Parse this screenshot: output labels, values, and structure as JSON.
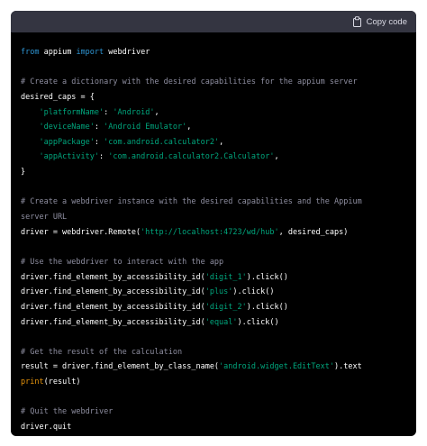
{
  "header": {
    "copy_label": "Copy code"
  },
  "code": {
    "l1": {
      "kw1": "from",
      "t1": " appium ",
      "kw2": "import",
      "t2": " webdriver"
    },
    "l3": "# Create a dictionary with the desired capabilities for the appium server",
    "l4": "desired_caps = {",
    "l5": {
      "pre": "    ",
      "key": "'platformName'",
      "sep": ": ",
      "val": "'Android'",
      "end": ","
    },
    "l6": {
      "pre": "    ",
      "key": "'deviceName'",
      "sep": ": ",
      "val": "'Android Emulator'",
      "end": ","
    },
    "l7": {
      "pre": "    ",
      "key": "'appPackage'",
      "sep": ": ",
      "val": "'com.android.calculator2'",
      "end": ","
    },
    "l8": {
      "pre": "    ",
      "key": "'appActivity'",
      "sep": ": ",
      "val": "'com.android.calculator2.Calculator'",
      "end": ","
    },
    "l9": "}",
    "l11": "# Create a webdriver instance with the desired capabilities and the Appium",
    "l12": "server URL",
    "l13": {
      "pre": "driver = webdriver.Remote(",
      "str": "'http://localhost:4723/wd/hub'",
      "post": ", desired_caps)"
    },
    "l15": "# Use the webdriver to interact with the app",
    "l16": {
      "pre": "driver.find_element_by_accessibility_id(",
      "str": "'digit_1'",
      "post": ").click()"
    },
    "l17": {
      "pre": "driver.find_element_by_accessibility_id(",
      "str": "'plus'",
      "post": ").click()"
    },
    "l18": {
      "pre": "driver.find_element_by_accessibility_id(",
      "str": "'digit_2'",
      "post": ").click()"
    },
    "l19": {
      "pre": "driver.find_element_by_accessibility_id(",
      "str": "'equal'",
      "post": ").click()"
    },
    "l21": "# Get the result of the calculation",
    "l22": {
      "pre": "result = driver.find_element_by_class_name(",
      "str": "'android.widget.EditText'",
      "post": ").text"
    },
    "l23": {
      "fn": "print",
      "post": "(result)"
    },
    "l25": "# Quit the webdriver",
    "l26": "driver.quit"
  },
  "colors": {
    "background": "#000000",
    "header": "#343541",
    "keyword": "#2e95d3",
    "string": "#00a67d",
    "comment": "#8e8ea0",
    "builtin": "#e9950c"
  }
}
